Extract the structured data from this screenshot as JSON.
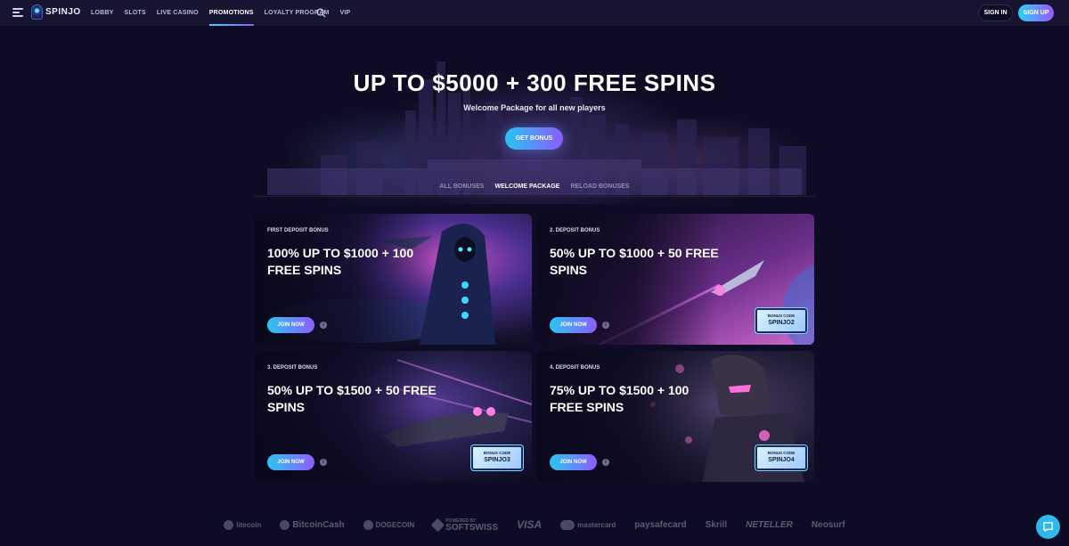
{
  "nav": {
    "logo_text": "SPINJO",
    "items": [
      {
        "label": "LOBBY",
        "active": false
      },
      {
        "label": "SLOTS",
        "active": false
      },
      {
        "label": "LIVE CASINO",
        "active": false
      },
      {
        "label": "PROMOTIONS",
        "active": true
      },
      {
        "label": "LOYALTY PROGRAM",
        "active": false
      },
      {
        "label": "VIP",
        "active": false
      }
    ],
    "signin_label": "SIGN IN",
    "signup_label": "SIGN UP"
  },
  "hero": {
    "title": "UP TO $5000 + 300 FREE SPINS",
    "subtitle": "Welcome Package for all new players",
    "cta_label": "GET BONUS"
  },
  "tabs": [
    {
      "label": "ALL BONUSES",
      "active": false
    },
    {
      "label": "WELCOME PACKAGE",
      "active": true
    },
    {
      "label": "RELOAD BONUSES",
      "active": false
    }
  ],
  "cards": [
    {
      "label": "FIRST DEPOSIT BONUS",
      "title": "100% UP TO $1000 + 100 FREE SPINS",
      "join_label": "JOIN NOW",
      "info": "i",
      "bonus_code_label": "",
      "bonus_code": ""
    },
    {
      "label": "2. DEPOSIT BONUS",
      "title": "50% UP TO $1000 + 50 FREE SPINS",
      "join_label": "JOIN NOW",
      "info": "i",
      "bonus_code_label": "BONUS CODE",
      "bonus_code": "SPINJO2"
    },
    {
      "label": "3. DEPOSIT BONUS",
      "title": "50% UP TO $1500 + 50 FREE SPINS",
      "join_label": "JOIN NOW",
      "info": "i",
      "bonus_code_label": "BONUS CODE",
      "bonus_code": "SPINJO3"
    },
    {
      "label": "4. DEPOSIT BONUS",
      "title": "75% UP TO $1500 + 100 FREE SPINS",
      "join_label": "JOIN NOW",
      "info": "i",
      "bonus_code_label": "BONUS CODE",
      "bonus_code": "SPINJO4"
    }
  ],
  "payments": [
    "litecoin",
    "BitcoinCash",
    "DOGECOIN",
    "SOFTSWISS",
    "VISA",
    "mastercard",
    "paysafecard",
    "Skrill",
    "NETELLER",
    "Neosurf"
  ],
  "payments_softswiss_prefix": "POWERED BY",
  "colors": {
    "background": "#0e0c24",
    "nav_bg": "#171431",
    "accent_start": "#2fd0f6",
    "accent_end": "#9a57ff"
  }
}
